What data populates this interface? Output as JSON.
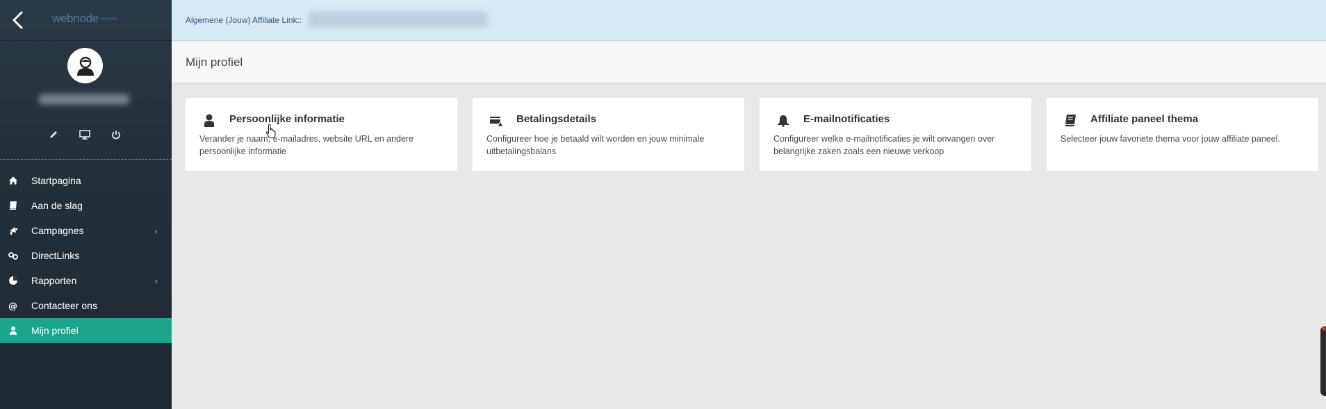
{
  "sidebar": {
    "logo_text": "webnode",
    "logo_sub": "AFFILIATE",
    "nav": [
      {
        "label": "Startpagina",
        "icon": "home-icon",
        "chevron": ""
      },
      {
        "label": "Aan de slag",
        "icon": "book-icon",
        "chevron": ""
      },
      {
        "label": "Campagnes",
        "icon": "campaign-icon",
        "chevron": "‹"
      },
      {
        "label": "DirectLinks",
        "icon": "link-icon",
        "chevron": ""
      },
      {
        "label": "Rapporten",
        "icon": "chart-icon",
        "chevron": "‹"
      },
      {
        "label": "Contacteer ons",
        "icon": "at-icon",
        "chevron": ""
      },
      {
        "label": "Mijn profiel",
        "icon": "user-icon",
        "chevron": ""
      }
    ],
    "active_index": 6
  },
  "topbar": {
    "affiliate_label": "Algemene (Jouw) Affiliate Link::"
  },
  "header": {
    "title": "Mijn profiel"
  },
  "cards": [
    {
      "title": "Persoonlijke informatie",
      "desc": "Verander je naam, e-mailadres, website URL en andere persoonlijke informatie",
      "icon": "user-icon"
    },
    {
      "title": "Betalingsdetails",
      "desc": "Configureer hoe je betaald wilt worden en jouw minimale uitbetalingsbalans",
      "icon": "payment-icon"
    },
    {
      "title": "E-mailnotificaties",
      "desc": "Configureer welke e-mailnotificaties je wilt onvangen over belangrijke zaken zoals een nieuwe verkoop",
      "icon": "bell-icon"
    },
    {
      "title": "Affiliate paneel thema",
      "desc": "Selecteer jouw favoriete thema voor jouw affiliate paneel.",
      "icon": "book-icon"
    }
  ],
  "colors": {
    "sidebar_bg": "#243039",
    "active_bg": "#1aa68a",
    "topbar_bg": "#d7e9f2"
  }
}
